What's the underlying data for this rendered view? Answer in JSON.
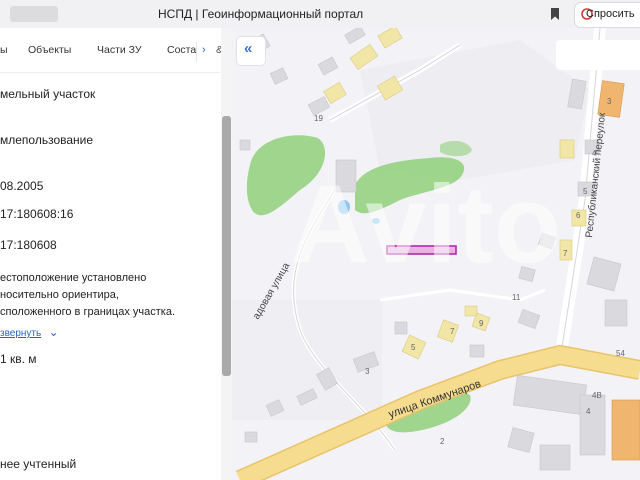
{
  "browser": {
    "page_title": "НСПД | Геоинформационный портал",
    "ask_button": "Спросить",
    "icons": {
      "bookmark": "bookmark-icon",
      "ask": "assistant-icon"
    }
  },
  "panel": {
    "tabs": [
      "ы",
      "Объекты",
      "Части ЗУ",
      "Состав"
    ],
    "tab_arrow": "›",
    "tab_overflow": "&",
    "fields": {
      "type": "мельный участок",
      "use": "млепользование",
      "date": "08.2005",
      "cad_number": "17:180608:16",
      "quarter": "17:180608",
      "location_1": "естоположение установлено",
      "location_2": "носительно ориентира,",
      "location_3": "сположенного в границах участка.",
      "expand_link": "звернуть",
      "expand_caret": "⌄",
      "area": "1 кв. м",
      "status": "нее учтенный"
    }
  },
  "map": {
    "collapse_label": "«",
    "streets": {
      "kommunarov": "улица  Коммунаров",
      "sadovaya": "адовая  улица",
      "respublikanskiy": "Республиканский  переулок"
    },
    "house_numbers": [
      "19",
      "3",
      "4",
      "5",
      "6",
      "7",
      "11",
      "9",
      "7",
      "5",
      "3",
      "2",
      "4",
      "4B",
      "54"
    ],
    "watermark": "Avito",
    "colors": {
      "road": "#f6dc8e",
      "road_edge": "#e8c36b",
      "green": "#8fd07a",
      "building": "#d9d9de",
      "yellow_building": "#f1e6a6",
      "orange_building": "#f0b66f",
      "highlight": "#b02aa8",
      "highlight_fill": "#e7b3e0",
      "water": "#8fc5ef"
    }
  }
}
